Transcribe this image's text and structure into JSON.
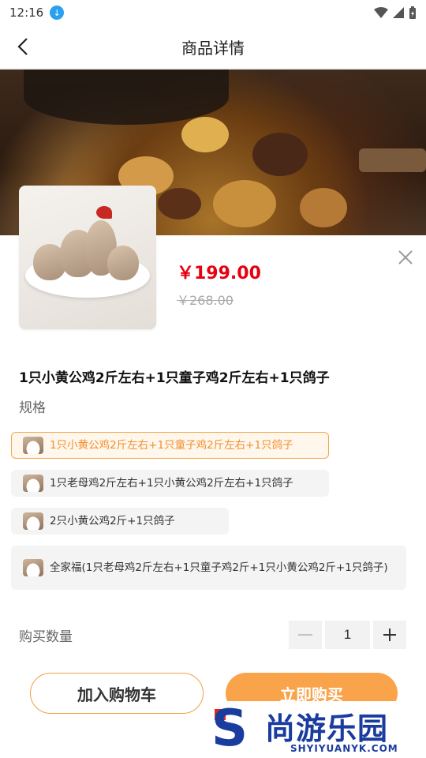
{
  "status": {
    "time": "12:16"
  },
  "nav": {
    "title": "商品详情"
  },
  "product": {
    "price": "￥199.00",
    "original_price": "￥268.00",
    "title": "1只小黄公鸡2斤左右+1只童子鸡2斤左右+1只鸽子"
  },
  "spec": {
    "label": "规格",
    "options": [
      "1只小黄公鸡2斤左右+1只童子鸡2斤左右+1只鸽子",
      "1只老母鸡2斤左右+1只小黄公鸡2斤左右+1只鸽子",
      "2只小黄公鸡2斤+1只鸽子",
      "全家福(1只老母鸡2斤左右+1只童子鸡2斤+1只小黄公鸡2斤+1只鸽子)"
    ],
    "selected_index": 0
  },
  "quantity": {
    "label": "购买数量",
    "value": "1"
  },
  "actions": {
    "add_to_cart": "加入购物车",
    "buy_now": "立即购买"
  },
  "watermark": {
    "cn": "尚游乐园",
    "en": "SHYIYUANYK.COM",
    "letter": "S"
  },
  "colors": {
    "accent": "#f9a44a",
    "price": "#e60012",
    "selected_bg": "#fff7ec"
  }
}
